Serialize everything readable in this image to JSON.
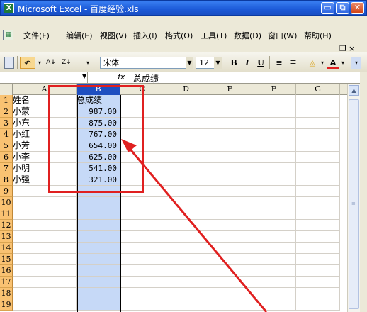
{
  "window": {
    "title": "Microsoft Excel - 百度经验.xls",
    "app_icon": "X",
    "minimize_label": "▭",
    "restore_label": "⧉",
    "close_label": "✕"
  },
  "menu": {
    "items": [
      "文件(F)",
      "编辑(E)",
      "视图(V)",
      "插入(I)",
      "格式(O)",
      "工具(T)",
      "数据(D)",
      "窗口(W)",
      "帮助(H)"
    ],
    "doc_min": "_",
    "doc_restore": "❐",
    "doc_close": "×"
  },
  "toolbar": {
    "font_name": "宋体",
    "font_size": "12",
    "bold": "B",
    "italic": "I",
    "underline": "U",
    "sort_asc": "A↓",
    "sort_desc": "Z↓",
    "font_color_label": "A"
  },
  "formula_bar": {
    "fx": "fx",
    "content": "总成绩"
  },
  "sheet": {
    "columns": [
      "A",
      "B",
      "C",
      "D",
      "E",
      "F",
      "G"
    ],
    "selected_column": "B",
    "rows": [
      {
        "n": "1",
        "a": "姓名",
        "b": "总成绩"
      },
      {
        "n": "2",
        "a": "小蒙",
        "b": "987.00"
      },
      {
        "n": "3",
        "a": "小东",
        "b": "875.00"
      },
      {
        "n": "4",
        "a": "小红",
        "b": "767.00"
      },
      {
        "n": "5",
        "a": "小芳",
        "b": "654.00"
      },
      {
        "n": "6",
        "a": "小李",
        "b": "625.00"
      },
      {
        "n": "7",
        "a": "小明",
        "b": "541.00"
      },
      {
        "n": "8",
        "a": "小强",
        "b": "321.00"
      },
      {
        "n": "9",
        "a": "",
        "b": ""
      },
      {
        "n": "10",
        "a": "",
        "b": ""
      },
      {
        "n": "11",
        "a": "",
        "b": ""
      },
      {
        "n": "12",
        "a": "",
        "b": ""
      },
      {
        "n": "13",
        "a": "",
        "b": ""
      },
      {
        "n": "14",
        "a": "",
        "b": ""
      },
      {
        "n": "15",
        "a": "",
        "b": ""
      },
      {
        "n": "16",
        "a": "",
        "b": ""
      },
      {
        "n": "17",
        "a": "",
        "b": ""
      },
      {
        "n": "18",
        "a": "",
        "b": ""
      },
      {
        "n": "19",
        "a": "",
        "b": ""
      }
    ]
  },
  "annotations": {
    "highlight_color": "#e02020",
    "arrow_color": "#e02020"
  }
}
